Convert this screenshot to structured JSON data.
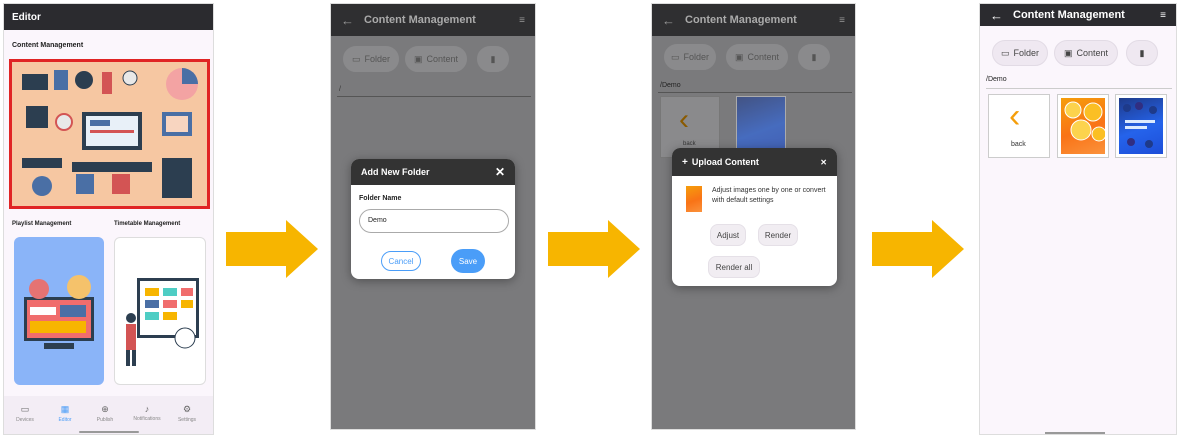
{
  "screen1": {
    "title": "Editor",
    "section_content": "Content Management",
    "section_playlist": "Playlist Management",
    "section_timetable": "Timetable Management",
    "nav": [
      {
        "label": "Devices",
        "icon": "monitor-icon"
      },
      {
        "label": "Editor",
        "icon": "grid-icon"
      },
      {
        "label": "Publish",
        "icon": "plus-circle-icon"
      },
      {
        "label": "Notifications",
        "icon": "bell-icon"
      },
      {
        "label": "Settings",
        "icon": "gear-icon"
      }
    ]
  },
  "screen2": {
    "title": "Content Management",
    "folder_label": "Folder",
    "content_label": "Content",
    "path": "/",
    "dialog": {
      "title": "Add New Folder",
      "field_label": "Folder Name",
      "field_value": "Demo",
      "cancel_label": "Cancel",
      "save_label": "Save"
    }
  },
  "screen3": {
    "title": "Content Management",
    "folder_label": "Folder",
    "content_label": "Content",
    "path": "/Demo",
    "back_label": "back",
    "dialog": {
      "title": "Upload Content",
      "message": "Adjust images one by one or convert with default settings",
      "adjust_label": "Adjust",
      "render_label": "Render",
      "render_all_label": "Render all"
    }
  },
  "screen4": {
    "title": "Content Management",
    "folder_label": "Folder",
    "content_label": "Content",
    "path": "/Demo",
    "back_label": "back"
  },
  "colors": {
    "accent_blue": "#4a9df8",
    "arrow_yellow": "#f7b500",
    "appbar_dark": "#2b2b2f",
    "selection_red": "#e02424",
    "back_chevron_orange": "#f59e0b"
  }
}
